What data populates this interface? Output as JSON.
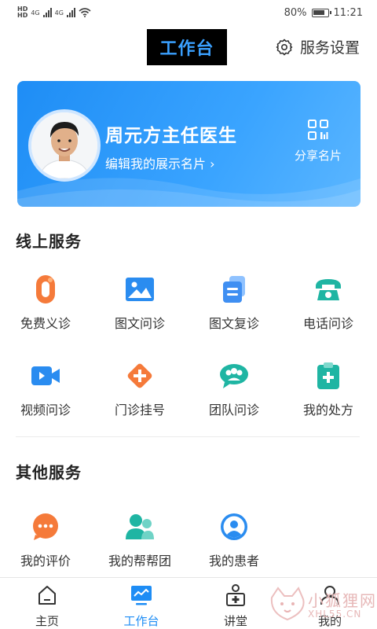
{
  "status_bar": {
    "network1": "4G",
    "network2": "4G",
    "battery": "80%",
    "time": "11:21"
  },
  "header": {
    "title": "工作台",
    "settings_label": "服务设置"
  },
  "doctor_card": {
    "name": "周元方主任医生",
    "edit_link": "编辑我的展示名片",
    "share_label": "分享名片"
  },
  "online_services": {
    "title": "线上服务",
    "items": [
      {
        "label": "免费义诊",
        "icon": "free-consult-icon"
      },
      {
        "label": "图文问诊",
        "icon": "image-text-consult-icon"
      },
      {
        "label": "图文复诊",
        "icon": "image-text-followup-icon"
      },
      {
        "label": "电话问诊",
        "icon": "phone-consult-icon"
      },
      {
        "label": "视频问诊",
        "icon": "video-consult-icon"
      },
      {
        "label": "门诊挂号",
        "icon": "clinic-register-icon"
      },
      {
        "label": "团队问诊",
        "icon": "team-consult-icon"
      },
      {
        "label": "我的处方",
        "icon": "prescription-icon"
      }
    ]
  },
  "other_services": {
    "title": "其他服务",
    "items": [
      {
        "label": "我的评价",
        "icon": "reviews-icon"
      },
      {
        "label": "我的帮帮团",
        "icon": "help-team-icon"
      },
      {
        "label": "我的患者",
        "icon": "patients-icon"
      }
    ]
  },
  "tabs": [
    {
      "label": "主页",
      "active": false
    },
    {
      "label": "工作台",
      "active": true
    },
    {
      "label": "讲堂",
      "active": false
    },
    {
      "label": "我的",
      "active": false
    }
  ],
  "watermark": {
    "text": "小狐狸网",
    "sub": "XHL55.CN"
  },
  "colors": {
    "brand_blue": "#1e8df5",
    "orange": "#f57a3a",
    "teal": "#22b8a8"
  }
}
